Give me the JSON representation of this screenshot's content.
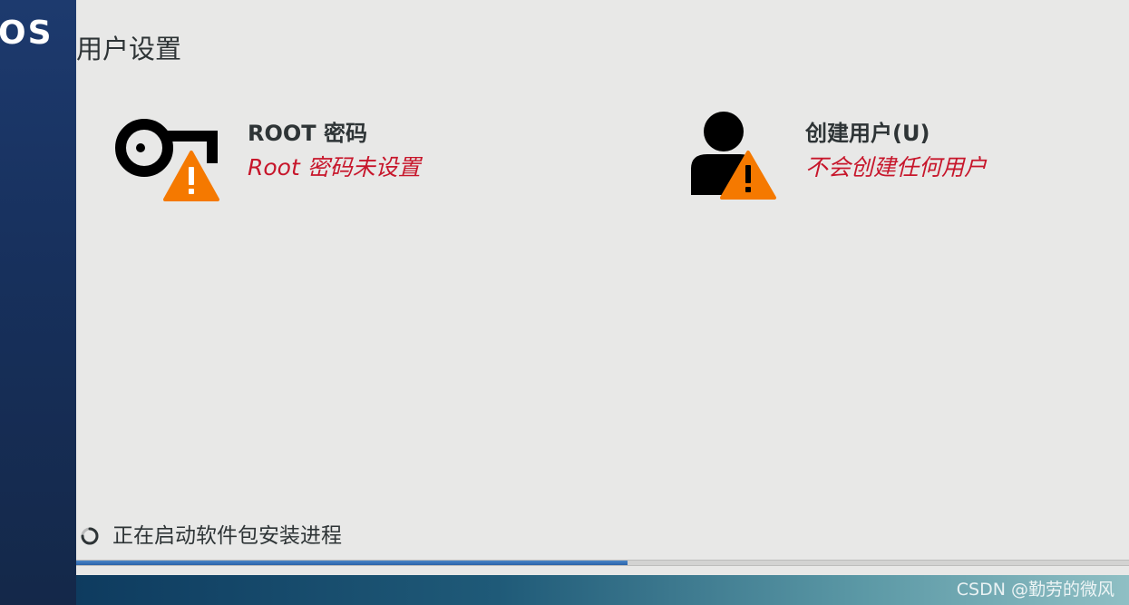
{
  "brand": {
    "logo_text": "OS"
  },
  "page": {
    "title": "用户设置"
  },
  "spokes": [
    {
      "id": "root-password",
      "icon": "key-warning-icon",
      "title": "ROOT 密码",
      "status": "Root 密码未设置"
    },
    {
      "id": "create-user",
      "icon": "user-warning-icon",
      "title": "创建用户(U)",
      "status": "不会创建任何用户"
    }
  ],
  "progress": {
    "message": "正在启动软件包安装进程",
    "fraction": 0.524
  },
  "watermark": "CSDN @勤劳的微风",
  "colors": {
    "sidebar": "#1d3a6e",
    "status_warning_text": "#c7162b",
    "warning_badge": "#f57900",
    "progress_fill": "#2a62a8"
  }
}
